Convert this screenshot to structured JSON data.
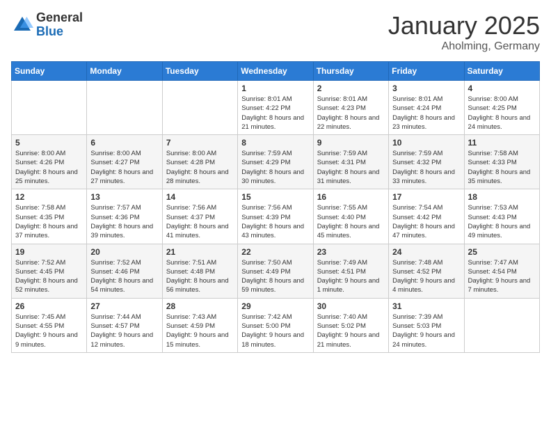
{
  "header": {
    "logo": {
      "general": "General",
      "blue": "Blue"
    },
    "title": "January 2025",
    "location": "Aholming, Germany"
  },
  "calendar": {
    "days_of_week": [
      "Sunday",
      "Monday",
      "Tuesday",
      "Wednesday",
      "Thursday",
      "Friday",
      "Saturday"
    ],
    "weeks": [
      [
        {
          "day": "",
          "sunrise": "",
          "sunset": "",
          "daylight": ""
        },
        {
          "day": "",
          "sunrise": "",
          "sunset": "",
          "daylight": ""
        },
        {
          "day": "",
          "sunrise": "",
          "sunset": "",
          "daylight": ""
        },
        {
          "day": "1",
          "sunrise": "8:01 AM",
          "sunset": "4:22 PM",
          "daylight": "8 hours and 21 minutes."
        },
        {
          "day": "2",
          "sunrise": "8:01 AM",
          "sunset": "4:23 PM",
          "daylight": "8 hours and 22 minutes."
        },
        {
          "day": "3",
          "sunrise": "8:01 AM",
          "sunset": "4:24 PM",
          "daylight": "8 hours and 23 minutes."
        },
        {
          "day": "4",
          "sunrise": "8:00 AM",
          "sunset": "4:25 PM",
          "daylight": "8 hours and 24 minutes."
        }
      ],
      [
        {
          "day": "5",
          "sunrise": "8:00 AM",
          "sunset": "4:26 PM",
          "daylight": "8 hours and 25 minutes."
        },
        {
          "day": "6",
          "sunrise": "8:00 AM",
          "sunset": "4:27 PM",
          "daylight": "8 hours and 27 minutes."
        },
        {
          "day": "7",
          "sunrise": "8:00 AM",
          "sunset": "4:28 PM",
          "daylight": "8 hours and 28 minutes."
        },
        {
          "day": "8",
          "sunrise": "7:59 AM",
          "sunset": "4:29 PM",
          "daylight": "8 hours and 30 minutes."
        },
        {
          "day": "9",
          "sunrise": "7:59 AM",
          "sunset": "4:31 PM",
          "daylight": "8 hours and 31 minutes."
        },
        {
          "day": "10",
          "sunrise": "7:59 AM",
          "sunset": "4:32 PM",
          "daylight": "8 hours and 33 minutes."
        },
        {
          "day": "11",
          "sunrise": "7:58 AM",
          "sunset": "4:33 PM",
          "daylight": "8 hours and 35 minutes."
        }
      ],
      [
        {
          "day": "12",
          "sunrise": "7:58 AM",
          "sunset": "4:35 PM",
          "daylight": "8 hours and 37 minutes."
        },
        {
          "day": "13",
          "sunrise": "7:57 AM",
          "sunset": "4:36 PM",
          "daylight": "8 hours and 39 minutes."
        },
        {
          "day": "14",
          "sunrise": "7:56 AM",
          "sunset": "4:37 PM",
          "daylight": "8 hours and 41 minutes."
        },
        {
          "day": "15",
          "sunrise": "7:56 AM",
          "sunset": "4:39 PM",
          "daylight": "8 hours and 43 minutes."
        },
        {
          "day": "16",
          "sunrise": "7:55 AM",
          "sunset": "4:40 PM",
          "daylight": "8 hours and 45 minutes."
        },
        {
          "day": "17",
          "sunrise": "7:54 AM",
          "sunset": "4:42 PM",
          "daylight": "8 hours and 47 minutes."
        },
        {
          "day": "18",
          "sunrise": "7:53 AM",
          "sunset": "4:43 PM",
          "daylight": "8 hours and 49 minutes."
        }
      ],
      [
        {
          "day": "19",
          "sunrise": "7:52 AM",
          "sunset": "4:45 PM",
          "daylight": "8 hours and 52 minutes."
        },
        {
          "day": "20",
          "sunrise": "7:52 AM",
          "sunset": "4:46 PM",
          "daylight": "8 hours and 54 minutes."
        },
        {
          "day": "21",
          "sunrise": "7:51 AM",
          "sunset": "4:48 PM",
          "daylight": "8 hours and 56 minutes."
        },
        {
          "day": "22",
          "sunrise": "7:50 AM",
          "sunset": "4:49 PM",
          "daylight": "8 hours and 59 minutes."
        },
        {
          "day": "23",
          "sunrise": "7:49 AM",
          "sunset": "4:51 PM",
          "daylight": "9 hours and 1 minute."
        },
        {
          "day": "24",
          "sunrise": "7:48 AM",
          "sunset": "4:52 PM",
          "daylight": "9 hours and 4 minutes."
        },
        {
          "day": "25",
          "sunrise": "7:47 AM",
          "sunset": "4:54 PM",
          "daylight": "9 hours and 7 minutes."
        }
      ],
      [
        {
          "day": "26",
          "sunrise": "7:45 AM",
          "sunset": "4:55 PM",
          "daylight": "9 hours and 9 minutes."
        },
        {
          "day": "27",
          "sunrise": "7:44 AM",
          "sunset": "4:57 PM",
          "daylight": "9 hours and 12 minutes."
        },
        {
          "day": "28",
          "sunrise": "7:43 AM",
          "sunset": "4:59 PM",
          "daylight": "9 hours and 15 minutes."
        },
        {
          "day": "29",
          "sunrise": "7:42 AM",
          "sunset": "5:00 PM",
          "daylight": "9 hours and 18 minutes."
        },
        {
          "day": "30",
          "sunrise": "7:40 AM",
          "sunset": "5:02 PM",
          "daylight": "9 hours and 21 minutes."
        },
        {
          "day": "31",
          "sunrise": "7:39 AM",
          "sunset": "5:03 PM",
          "daylight": "9 hours and 24 minutes."
        },
        {
          "day": "",
          "sunrise": "",
          "sunset": "",
          "daylight": ""
        }
      ]
    ]
  }
}
